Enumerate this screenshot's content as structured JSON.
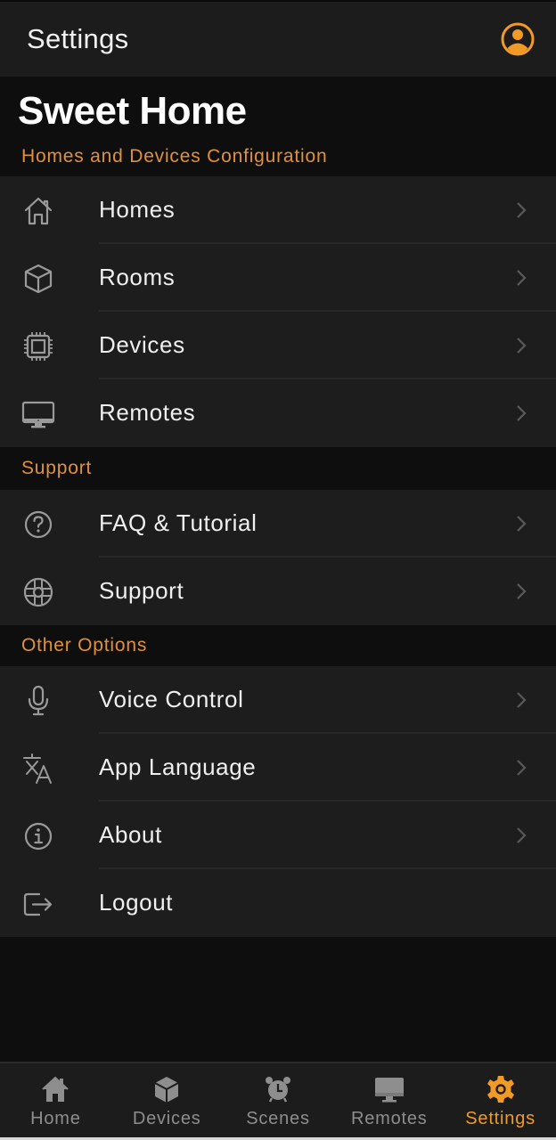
{
  "topbar": {
    "title": "Settings",
    "account_icon": "account-circle-icon"
  },
  "home_name": "Sweet Home",
  "colors": {
    "accent": "#f29a26",
    "section_header": "#e0913b",
    "row_background": "#1d1d1d",
    "page_background": "#0e0e0e",
    "icon_gray": "#9a9a9a"
  },
  "sections": [
    {
      "header": "Homes and Devices Configuration",
      "items": [
        {
          "label": "Homes",
          "icon": "house-icon",
          "chevron": true
        },
        {
          "label": "Rooms",
          "icon": "cube-icon",
          "chevron": true
        },
        {
          "label": "Devices",
          "icon": "chip-icon",
          "chevron": true
        },
        {
          "label": "Remotes",
          "icon": "monitor-icon",
          "chevron": true
        }
      ]
    },
    {
      "header": "Support",
      "items": [
        {
          "label": "FAQ & Tutorial",
          "icon": "question-circle-icon",
          "chevron": true
        },
        {
          "label": "Support",
          "icon": "lifebuoy-icon",
          "chevron": true
        }
      ]
    },
    {
      "header": "Other Options",
      "items": [
        {
          "label": "Voice Control",
          "icon": "microphone-icon",
          "chevron": true
        },
        {
          "label": "App Language",
          "icon": "translate-icon",
          "chevron": true
        },
        {
          "label": "About",
          "icon": "info-circle-icon",
          "chevron": true
        },
        {
          "label": "Logout",
          "icon": "logout-icon",
          "chevron": false
        }
      ]
    }
  ],
  "bottom_nav": {
    "active": "Settings",
    "tabs": [
      {
        "label": "Home",
        "icon": "house-filled-icon"
      },
      {
        "label": "Devices",
        "icon": "cube-filled-icon"
      },
      {
        "label": "Scenes",
        "icon": "alarm-clock-icon"
      },
      {
        "label": "Remotes",
        "icon": "monitor-filled-icon"
      },
      {
        "label": "Settings",
        "icon": "gear-icon"
      }
    ]
  }
}
